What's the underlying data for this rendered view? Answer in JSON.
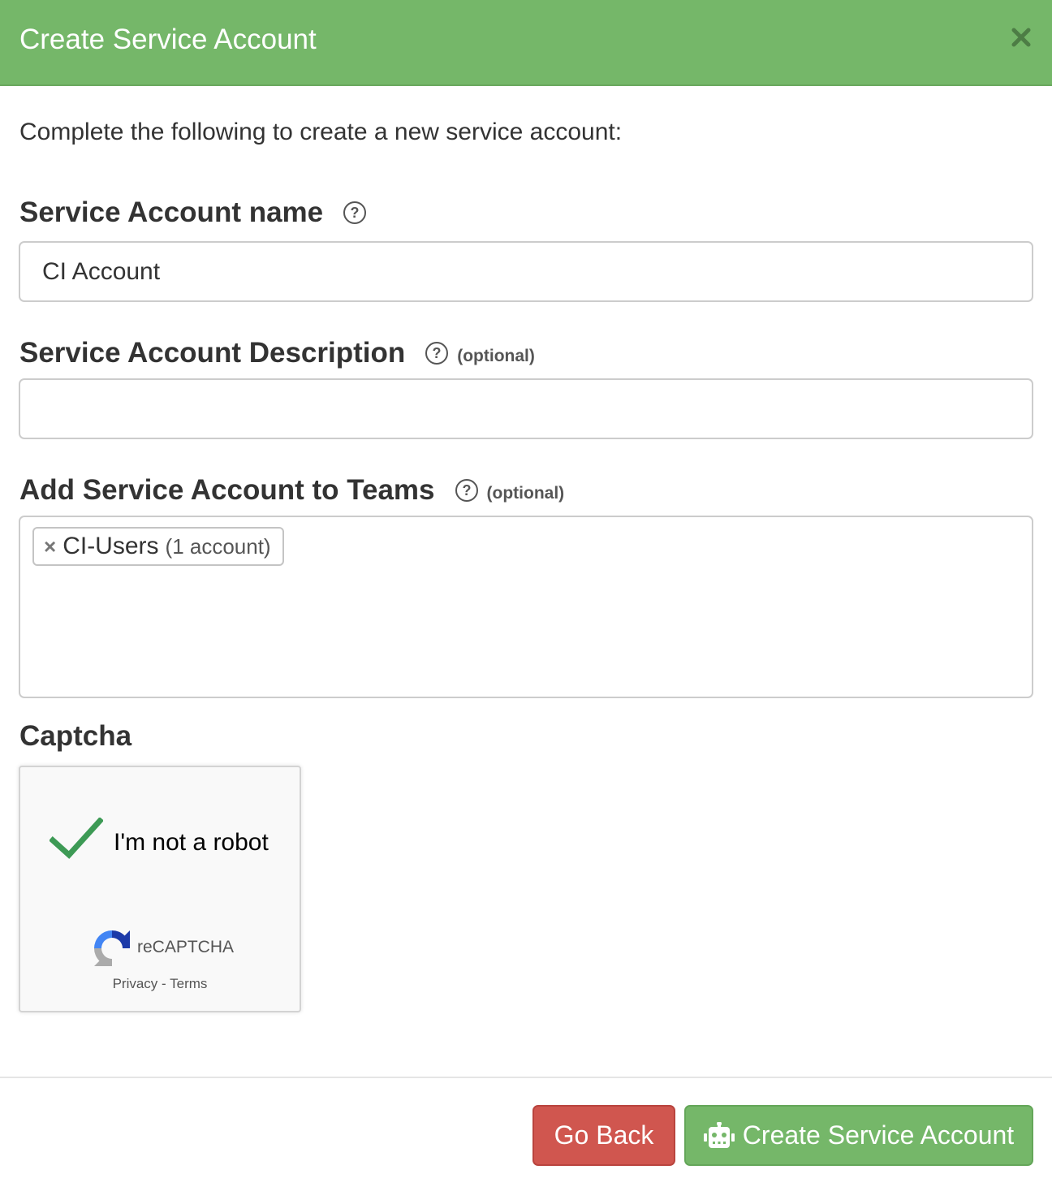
{
  "header": {
    "title": "Create Service Account"
  },
  "intro": "Complete the following to create a new service account:",
  "fields": {
    "name": {
      "label": "Service Account name",
      "value": "CI Account",
      "placeholder": ""
    },
    "description": {
      "label": "Service Account Description",
      "optional": "(optional)",
      "value": "",
      "placeholder": ""
    },
    "teams": {
      "label": "Add Service Account to Teams",
      "optional": "(optional)",
      "selected": [
        {
          "name": "CI-Users",
          "count": "(1 account)"
        }
      ]
    }
  },
  "captcha": {
    "label": "Captcha",
    "checkbox_text": "I'm not a robot",
    "brand": "reCAPTCHA",
    "privacy": "Privacy",
    "separator": "-",
    "terms": "Terms",
    "checked": true
  },
  "footer": {
    "back_label": "Go Back",
    "create_label": "Create Service Account"
  },
  "colors": {
    "header_bg": "#75b769",
    "primary_button": "#75b769",
    "danger_button": "#d0564f"
  },
  "icons": {
    "close": "close-icon",
    "help": "question-circle-icon",
    "check": "checkmark-icon",
    "recaptcha": "recaptcha-logo-icon",
    "robot": "robot-icon"
  }
}
